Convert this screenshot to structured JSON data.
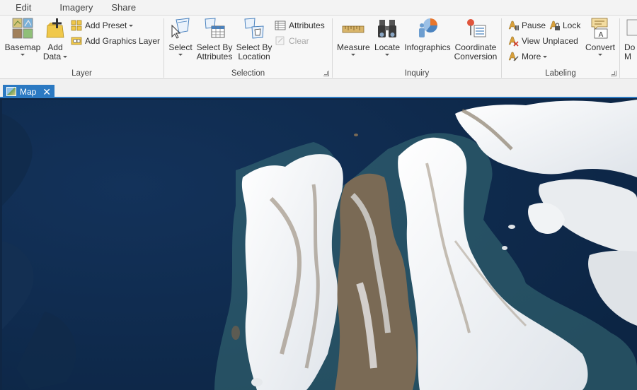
{
  "menu_tabs": [
    "Edit",
    "Imagery",
    "Share"
  ],
  "groups": {
    "layer": {
      "label": "Layer",
      "basemap": "Basemap",
      "add_data": "Add Data",
      "add_data_line1": "Add",
      "add_data_line2": "Data",
      "add_preset": "Add Preset",
      "add_graphics_layer": "Add Graphics Layer"
    },
    "selection": {
      "label": "Selection",
      "select": "Select",
      "select_by_attributes_1": "Select By",
      "select_by_attributes_2": "Attributes",
      "select_by_location_1": "Select By",
      "select_by_location_2": "Location",
      "attributes": "Attributes",
      "clear": "Clear"
    },
    "inquiry": {
      "label": "Inquiry",
      "measure": "Measure",
      "locate": "Locate",
      "infographics": "Infographics",
      "coord_1": "Coordinate",
      "coord_2": "Conversion"
    },
    "labeling": {
      "label": "Labeling",
      "pause": "Pause",
      "lock": "Lock",
      "view_unplaced": "View Unplaced",
      "more": "More",
      "convert": "Convert"
    },
    "overflow": {
      "label_1": "Do",
      "label_2": "M"
    }
  },
  "view_tab": {
    "title": "Map",
    "close": "✕"
  },
  "colors": {
    "accent": "#2b79c2",
    "ocean": "#0f2a4b",
    "snow": "#eef0f2",
    "rock": "#7a6a55"
  }
}
